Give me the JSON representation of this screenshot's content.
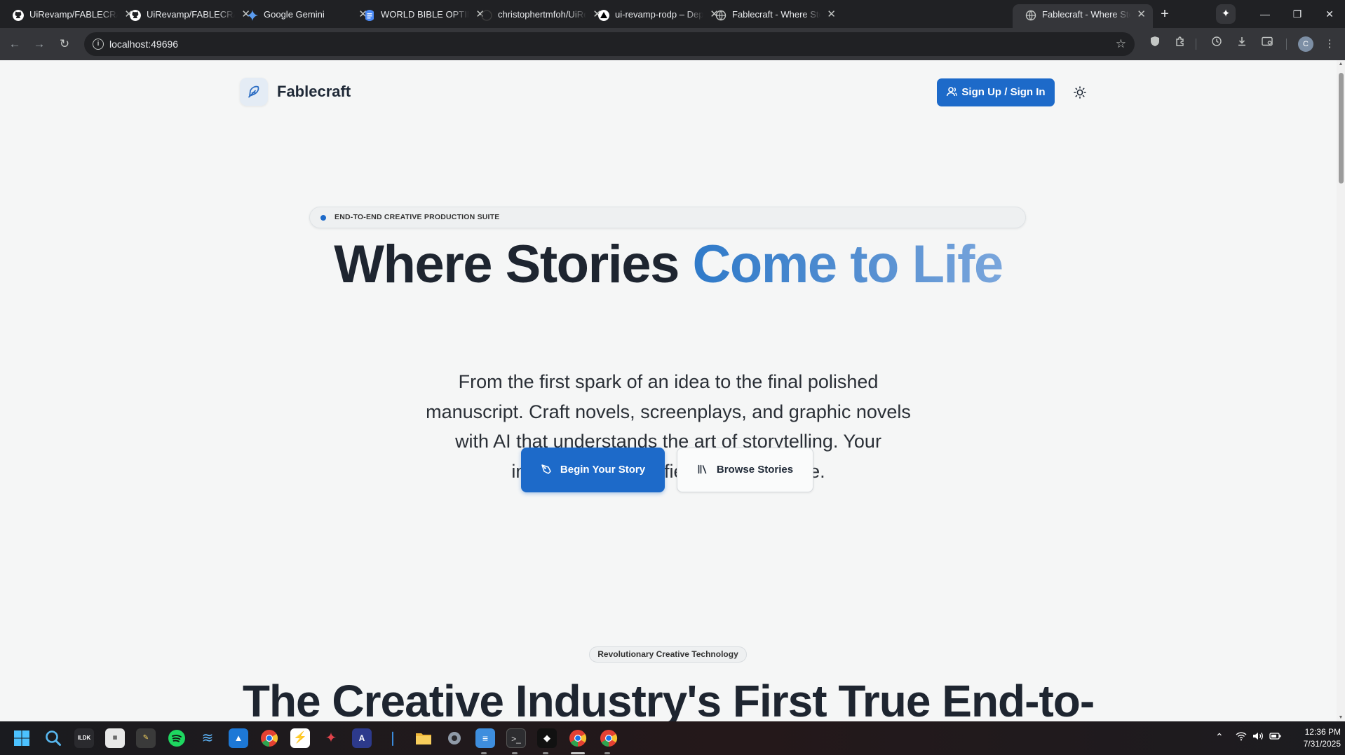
{
  "browser": {
    "tabs": [
      {
        "title": "UiRevamp/FABLECRAFT_",
        "icon": "github-icon",
        "active": false
      },
      {
        "title": "UiRevamp/FABLECRAFT_",
        "icon": "github-icon",
        "active": false
      },
      {
        "title": "Google Gemini",
        "icon": "gemini-icon",
        "active": false
      },
      {
        "title": "WORLD BIBLE OPTIMIZE",
        "icon": "docs-icon",
        "active": false
      },
      {
        "title": "christophertmfoh/UiRevamp",
        "icon": "github-icon",
        "active": false
      },
      {
        "title": "ui-revamp-rodp – Deploy",
        "icon": "vercel-icon",
        "active": false
      },
      {
        "title": "Fablecraft - Where Stories",
        "icon": "globe-icon",
        "active": false
      },
      {
        "title": "Fablecraft - Where Stories",
        "icon": "globe-icon",
        "active": true
      }
    ],
    "url": "localhost:49696",
    "profile_initial": "C"
  },
  "header": {
    "brand": "Fablecraft",
    "auth_button": "Sign Up / Sign In"
  },
  "hero": {
    "pill": "END-TO-END CREATIVE PRODUCTION SUITE",
    "title_plain": "Where Stories ",
    "title_accent": "Come to Life",
    "lead_lines": [
      "From the first spark of an idea to the final polished",
      "manuscript. Craft novels, screenplays, and graphic novels",
      "with AI that understands the art of storytelling. Your",
      "imagination, amplified by intelligence."
    ],
    "primary_cta": "Begin Your Story",
    "secondary_cta": "Browse Stories"
  },
  "section": {
    "badge": "Revolutionary Creative Technology",
    "title": "The Creative Industry's First True End-to-"
  },
  "taskbar": {
    "time": "12:36 PM",
    "date": "7/31/2025"
  },
  "colors": {
    "accent": "#1d6ac9",
    "background": "#f5f6f6",
    "text": "#1e2530"
  }
}
